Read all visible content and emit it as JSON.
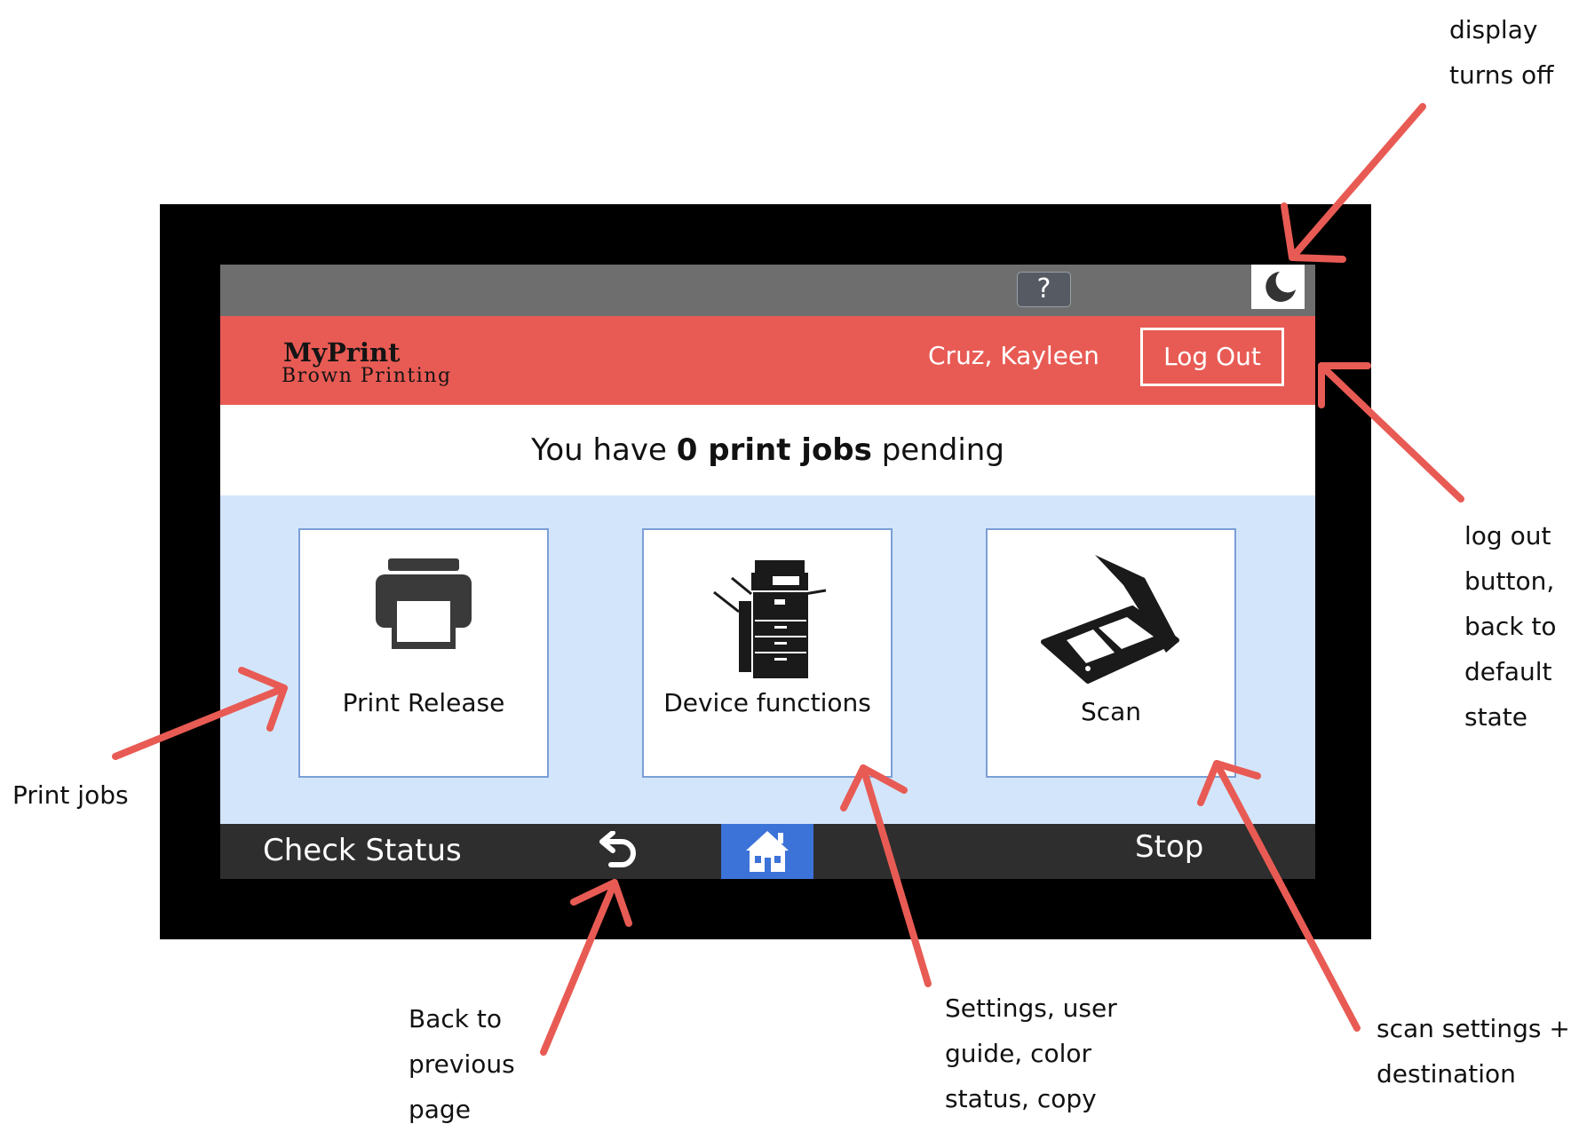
{
  "topbar": {
    "help_label": "?",
    "help_icon": "question-mark-icon",
    "sleep_icon": "moon-icon"
  },
  "header": {
    "brand_title": "MyPrint",
    "brand_subtitle": "Brown Printing",
    "user_name": "Cruz, Kayleen",
    "logout_label": "Log Out"
  },
  "pending": {
    "prefix": "You have ",
    "count_text": "0 print jobs",
    "suffix": " pending"
  },
  "tiles": [
    {
      "label": "Print Release",
      "icon": "printer-icon"
    },
    {
      "label": "Device functions",
      "icon": "copier-icon"
    },
    {
      "label": "Scan",
      "icon": "scanner-icon"
    }
  ],
  "bottombar": {
    "check_status_label": "Check Status",
    "back_icon": "undo-arrow-icon",
    "home_icon": "home-icon",
    "stop_label": "Stop"
  },
  "annotations": {
    "display_off": [
      "display",
      "turns off"
    ],
    "logout": [
      "log out",
      "button,",
      "back to",
      "default",
      "state"
    ],
    "print_jobs": [
      "Print jobs"
    ],
    "back": [
      "Back to",
      "previous",
      "page"
    ],
    "device": [
      "Settings, user",
      "guide, color",
      "status, copy"
    ],
    "scan": [
      "scan settings +",
      "destination"
    ]
  },
  "colors": {
    "header": "#e85b54",
    "topbar": "#6e6e6e",
    "tiles_bg": "#d3e5fb",
    "bottombar": "#2e2e2e",
    "home": "#3b73d8",
    "arrow": "#e85b54"
  }
}
